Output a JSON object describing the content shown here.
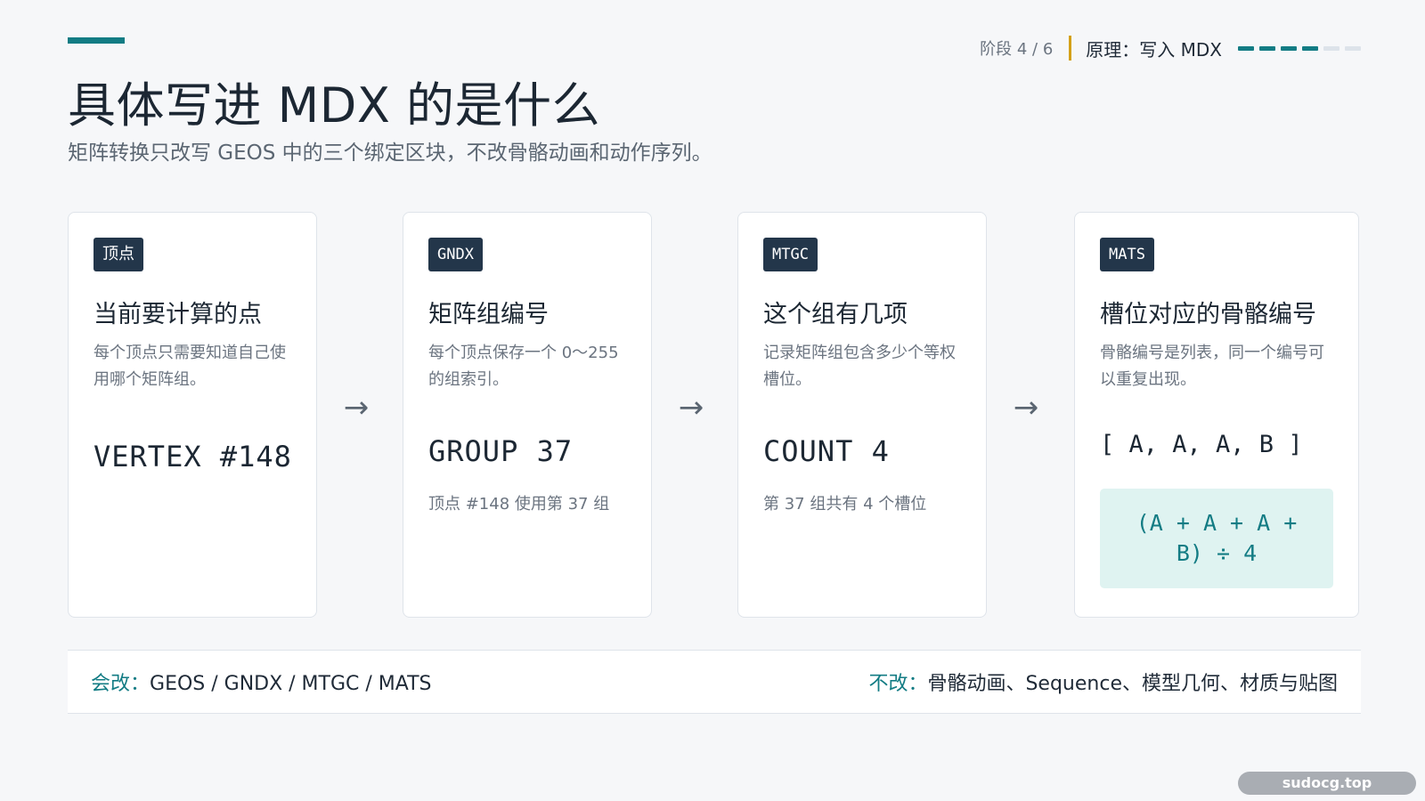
{
  "header": {
    "title": "具体写进 MDX 的是什么",
    "subtitle": "矩阵转换只改写 GEOS 中的三个绑定区块，不改骨骼动画和动作序列。"
  },
  "progress": {
    "stage": "阶段 4 / 6",
    "stage_name": "原理：写入 MDX",
    "current": 4,
    "total": 6,
    "accent_color": "#137c84"
  },
  "cards": [
    {
      "tag": "顶点",
      "title": "当前要计算的点",
      "desc": "每个顶点只需要知道自己使用哪个矩阵组。",
      "value": "VERTEX #148"
    },
    {
      "tag": "GNDX",
      "title": "矩阵组编号",
      "desc": "每个顶点保存一个 0～255 的组索引。",
      "value": "GROUP 37",
      "note": "顶点 #148 使用第 37 组"
    },
    {
      "tag": "MTGC",
      "title": "这个组有几项",
      "desc": "记录矩阵组包含多少个等权槽位。",
      "value": "COUNT 4",
      "note": "第 37 组共有 4 个槽位"
    },
    {
      "tag": "MATS",
      "title": "槽位对应的骨骼编号",
      "desc": "骨骼编号是列表，同一个编号可以重复出现。",
      "value": "[ A, A, A, B ]",
      "formula_line1": "(A + A + A +",
      "formula_line2": "B) ÷ 4"
    }
  ],
  "arrow_glyph": "→",
  "footer": {
    "changed_label": "会改：",
    "changed_text": "GEOS / GNDX / MTGC / MATS",
    "unchanged_label": "不改：",
    "unchanged_text": "骨骼动画、Sequence、模型几何、材质与贴图"
  },
  "watermark": "sudocg.top"
}
